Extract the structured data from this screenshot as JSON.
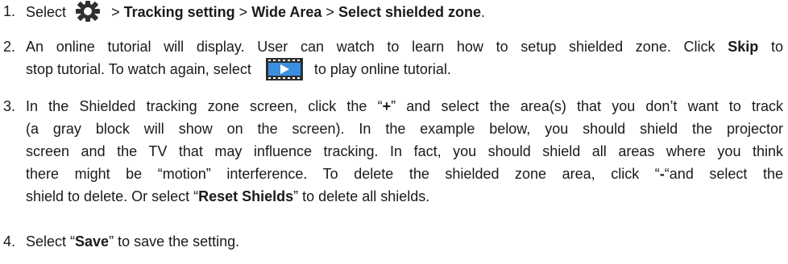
{
  "steps": [
    {
      "number": "1.",
      "select": "Select",
      "sep1": ">",
      "tracking_setting": "Tracking setting",
      "sep2": ">",
      "wide_area": "Wide Area",
      "sep3": ">",
      "shielded_zone": "Select shielded zone",
      "end": ".",
      "icon": "gear-icon"
    },
    {
      "number": "2.",
      "line1_a": "An online tutorial will display. User can watch to learn how to setup shielded zone. Click",
      "line1_bold": "Skip",
      "line1_b": "to",
      "line2_a": "stop tutorial. To watch again, select",
      "line2_b": "to play online tutorial.",
      "icon": "video-play-icon"
    },
    {
      "number": "3.",
      "line1_a": "In the Shielded tracking zone screen, click the “",
      "line1_bold": "+",
      "line1_b": "” and select the area(s) that you don’t want to track",
      "line2": "(a gray block will show on the screen).   In the example below, you should shield the projector",
      "line3": "screen and the TV that may influence tracking.   In fact, you should shield all areas where you think",
      "line4_a": "there might be “motion” interference.   To delete the shielded zone area, click “",
      "line4_bold": "-",
      "line4_b": "“and select the",
      "line5_a": "shield to delete. Or select “",
      "line5_bold": "Reset Shields",
      "line5_b": "” to delete all shields."
    },
    {
      "number": "4.",
      "a": "Select “",
      "bold": "Save",
      "b": "” to save the setting."
    }
  ],
  "colors": {
    "text": "#1a1a1a",
    "icon_dark": "#2f2f2f",
    "play_blue": "#3b8fe0"
  }
}
